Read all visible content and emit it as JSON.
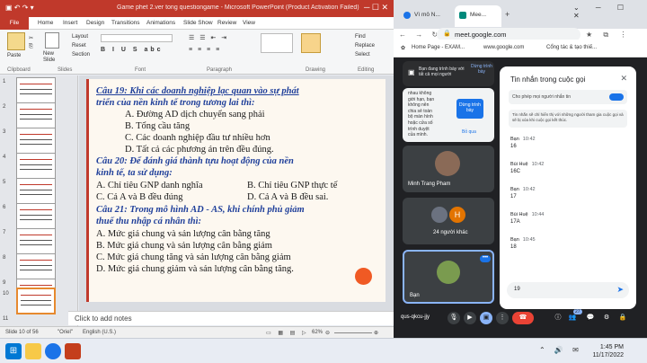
{
  "ppt": {
    "title": "Game phet 2.ver tong questiongame - Microsoft PowerPoint (Product Activation Failed)",
    "tabs": [
      "File",
      "Home",
      "Insert",
      "Design",
      "Transitions",
      "Animations",
      "Slide Show",
      "Review",
      "View"
    ],
    "ribbon": {
      "paste": "Paste",
      "new_slide": "New Slide",
      "layout": "Layout",
      "reset": "Reset",
      "section": "Section",
      "groups": [
        "Clipboard",
        "Slides",
        "Font",
        "Paragraph",
        "Drawing",
        "Editing"
      ],
      "find": "Find",
      "replace": "Replace",
      "select": "Select"
    },
    "thumb_numbers": [
      "1",
      "2",
      "3",
      "4",
      "5",
      "6",
      "7",
      "8",
      "9",
      "10",
      "11"
    ],
    "slide_lines": [
      {
        "text": "Câu 19: Khi các doanh nghiệp lạc quan vào sự phát",
        "kind": "q"
      },
      {
        "text": "triển của nền kinh tế trong tương lai thì:",
        "kind": "q"
      },
      {
        "text": "A. Đường AD dịch chuyển sang phải",
        "kind": "a"
      },
      {
        "text": "B. Tổng cầu tăng",
        "kind": "a"
      },
      {
        "text": "C. Các doanh nghiệp đầu tư nhiều hơn",
        "kind": "a"
      },
      {
        "text": "D. Tất cả các phương án trên đều đúng.",
        "kind": "a"
      },
      {
        "text": "Câu 20: Để đánh giá thành tựu hoạt động của nền",
        "kind": "q"
      },
      {
        "text": "kinh tế, ta sử dụng:",
        "kind": "q"
      },
      {
        "text": "A. Chỉ tiêu GNP danh nghĩa",
        "kind": "a"
      },
      {
        "text": "B. Chỉ tiêu GNP thực tế",
        "kind": "a"
      },
      {
        "text": "C. Cả A và B đều đúng",
        "kind": "a"
      },
      {
        "text": "D. Cả A và B đều sai.",
        "kind": "a"
      },
      {
        "text": "Câu 21: Trong mô hình AD - AS, khi chính phủ giảm",
        "kind": "q"
      },
      {
        "text": "thuế thu nhập cá nhân thì:",
        "kind": "q"
      },
      {
        "text": "A. Mức giá chung và sản lượng cân bằng tăng",
        "kind": "a"
      },
      {
        "text": "B. Mức giá chung và sản lượng cân bằng giảm",
        "kind": "a"
      },
      {
        "text": "C. Mức giá chung tăng và sản lượng cân bằng giảm",
        "kind": "a"
      },
      {
        "text": "D. Mức giá chung giảm và sản lượng cân bằng tăng.",
        "kind": "a"
      }
    ],
    "notes_placeholder": "Click to add notes",
    "status": {
      "slide": "Slide 10 of 56",
      "theme": "\"Oriel\"",
      "language": "English (U.S.)",
      "zoom": "62%"
    }
  },
  "chrome": {
    "tabs": [
      "Vì mô N...",
      "Mee..."
    ],
    "url": "meet.google.com",
    "bookmarks": [
      "Home Page - EXAM...",
      "www.google.com",
      "Cổng tác & tạo thiế..."
    ],
    "presenting_banner": "Bạn đang trình bày với tất cả mọi người",
    "stop_presenting": "Dừng trình bày",
    "share_snippet": [
      "nhau không",
      "giới hạn, bạn",
      "không nên",
      "chia sẻ toàn",
      "bộ màn hình",
      "hoặc cửa số",
      "trình duyệt",
      "của mình."
    ],
    "share_stop": "Dừng trình bày",
    "share_dismiss": "Bỏ qua",
    "participants": [
      {
        "name": "Minh Trang Pham"
      },
      {
        "name": "24 người khác",
        "avatar": "H"
      },
      {
        "name": "Bạn"
      }
    ],
    "chat": {
      "title": "Tin nhắn trong cuộc gọi",
      "toggle_label": "Cho phép mọi người nhắn tin",
      "notice": "Tin nhắn sẽ chỉ hiển thị với những người tham gia cuộc gọi và sẽ bị xóa khi cuộc gọi kết thúc.",
      "messages": [
        {
          "name": "Bạn",
          "time": "10:42",
          "text": "16"
        },
        {
          "name": "Bùi Huệ",
          "time": "10:42",
          "text": "16C"
        },
        {
          "name": "Bạn",
          "time": "10:42",
          "text": "17"
        },
        {
          "name": "Bùi Huệ",
          "time": "10:44",
          "text": "17A"
        },
        {
          "name": "Bạn",
          "time": "10:45",
          "text": "18"
        }
      ],
      "input_value": "19"
    },
    "meeting_code": "qus-qkcu-jjy",
    "participant_count": "27"
  },
  "taskbar": {
    "time": "1:45 PM",
    "date": "11/17/2022"
  }
}
